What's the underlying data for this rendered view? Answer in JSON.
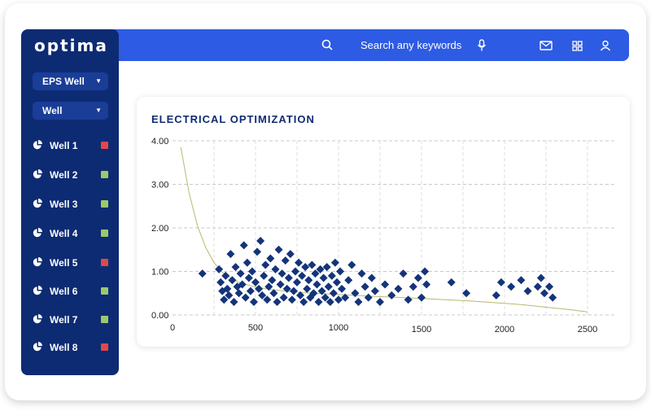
{
  "app": {
    "logo": "optima"
  },
  "header": {
    "search_placeholder": "Search any keywords"
  },
  "sidebar": {
    "dropdowns": [
      {
        "label": "EPS Well"
      },
      {
        "label": "Well"
      }
    ],
    "wells": [
      {
        "label": "Well 1",
        "status_color": "#e0484c"
      },
      {
        "label": "Well 2",
        "status_color": "#9cc86b"
      },
      {
        "label": "Well 3",
        "status_color": "#9cc86b"
      },
      {
        "label": "Well 4",
        "status_color": "#9cc86b"
      },
      {
        "label": "Well 5",
        "status_color": "#e0484c"
      },
      {
        "label": "Well 6",
        "status_color": "#9cc86b"
      },
      {
        "label": "Well 7",
        "status_color": "#9cc86b"
      },
      {
        "label": "Well 8",
        "status_color": "#e0484c"
      }
    ]
  },
  "colors": {
    "accent": "#2d5be3",
    "sidebar": "#0d2b73",
    "marker": "#14347a",
    "curve": "#b9b86f"
  },
  "chart_data": {
    "type": "scatter",
    "title": "ELECTRICAL OPTIMIZATION",
    "xlabel": "",
    "ylabel": "",
    "xlim": [
      0,
      2500
    ],
    "ylim": [
      0,
      4
    ],
    "x_ticks": [
      "0",
      "500",
      "1000",
      "1500",
      "2000",
      "2500"
    ],
    "y_ticks": [
      "0.00",
      "1.00",
      "2.00",
      "3.00",
      "4.00"
    ],
    "grid": true,
    "curve": {
      "x": [
        50,
        100,
        150,
        200,
        250,
        300,
        350,
        400,
        500,
        600,
        700,
        800,
        1000,
        1200,
        1500,
        1800,
        2100,
        2400,
        2500
      ],
      "y": [
        3.85,
        2.8,
        2.05,
        1.55,
        1.2,
        0.98,
        0.85,
        0.75,
        0.64,
        0.58,
        0.54,
        0.51,
        0.47,
        0.43,
        0.38,
        0.32,
        0.24,
        0.12,
        0.07
      ]
    },
    "series": [
      {
        "points": [
          [
            180,
            0.95
          ],
          [
            280,
            1.05
          ],
          [
            290,
            0.75
          ],
          [
            300,
            0.55
          ],
          [
            310,
            0.35
          ],
          [
            320,
            0.9
          ],
          [
            330,
            0.6
          ],
          [
            340,
            0.45
          ],
          [
            350,
            1.4
          ],
          [
            360,
            0.8
          ],
          [
            370,
            0.3
          ],
          [
            380,
            1.1
          ],
          [
            390,
            0.65
          ],
          [
            400,
            0.5
          ],
          [
            410,
            0.95
          ],
          [
            420,
            0.7
          ],
          [
            430,
            1.6
          ],
          [
            440,
            0.4
          ],
          [
            450,
            1.2
          ],
          [
            460,
            0.85
          ],
          [
            470,
            0.55
          ],
          [
            480,
            1.0
          ],
          [
            490,
            0.3
          ],
          [
            500,
            0.75
          ],
          [
            510,
            1.45
          ],
          [
            520,
            0.6
          ],
          [
            530,
            1.7
          ],
          [
            540,
            0.45
          ],
          [
            550,
            0.9
          ],
          [
            560,
            1.15
          ],
          [
            570,
            0.35
          ],
          [
            580,
            0.65
          ],
          [
            590,
            1.3
          ],
          [
            600,
            0.8
          ],
          [
            610,
            0.5
          ],
          [
            620,
            1.05
          ],
          [
            630,
            0.3
          ],
          [
            640,
            1.5
          ],
          [
            650,
            0.7
          ],
          [
            660,
            0.95
          ],
          [
            670,
            0.4
          ],
          [
            680,
            1.25
          ],
          [
            690,
            0.6
          ],
          [
            700,
            0.85
          ],
          [
            710,
            1.4
          ],
          [
            720,
            0.35
          ],
          [
            730,
            0.55
          ],
          [
            740,
            1.0
          ],
          [
            750,
            0.75
          ],
          [
            760,
            1.2
          ],
          [
            770,
            0.45
          ],
          [
            780,
            0.9
          ],
          [
            790,
            0.3
          ],
          [
            800,
            1.1
          ],
          [
            810,
            0.6
          ],
          [
            820,
            0.8
          ],
          [
            830,
            0.4
          ],
          [
            840,
            1.15
          ],
          [
            850,
            0.5
          ],
          [
            860,
            0.95
          ],
          [
            870,
            0.7
          ],
          [
            880,
            0.3
          ],
          [
            890,
            1.05
          ],
          [
            900,
            0.55
          ],
          [
            910,
            0.85
          ],
          [
            920,
            0.4
          ],
          [
            930,
            1.1
          ],
          [
            940,
            0.65
          ],
          [
            950,
            0.3
          ],
          [
            960,
            0.9
          ],
          [
            970,
            0.5
          ],
          [
            980,
            1.2
          ],
          [
            990,
            0.75
          ],
          [
            1000,
            0.35
          ],
          [
            1010,
            1.0
          ],
          [
            1020,
            0.6
          ],
          [
            1040,
            0.4
          ],
          [
            1060,
            0.8
          ],
          [
            1080,
            1.15
          ],
          [
            1100,
            0.5
          ],
          [
            1120,
            0.3
          ],
          [
            1140,
            0.95
          ],
          [
            1160,
            0.65
          ],
          [
            1180,
            0.4
          ],
          [
            1200,
            0.85
          ],
          [
            1220,
            0.55
          ],
          [
            1250,
            0.3
          ],
          [
            1280,
            0.7
          ],
          [
            1320,
            0.45
          ],
          [
            1360,
            0.6
          ],
          [
            1390,
            0.95
          ],
          [
            1420,
            0.35
          ],
          [
            1450,
            0.65
          ],
          [
            1480,
            0.85
          ],
          [
            1500,
            0.4
          ],
          [
            1520,
            1.0
          ],
          [
            1530,
            0.7
          ],
          [
            1680,
            0.75
          ],
          [
            1770,
            0.5
          ],
          [
            1950,
            0.45
          ],
          [
            1980,
            0.75
          ],
          [
            2040,
            0.65
          ],
          [
            2100,
            0.8
          ],
          [
            2140,
            0.55
          ],
          [
            2200,
            0.65
          ],
          [
            2220,
            0.85
          ],
          [
            2240,
            0.5
          ],
          [
            2270,
            0.65
          ],
          [
            2290,
            0.4
          ]
        ]
      }
    ]
  }
}
